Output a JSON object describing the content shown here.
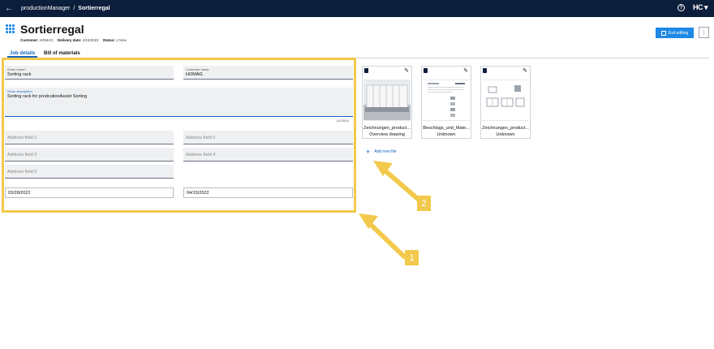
{
  "topbar": {
    "app": "productionManager",
    "separator": "/",
    "page": "Sortierregal",
    "help": "?",
    "logo": "HC"
  },
  "header": {
    "title": "Sortierregal",
    "customer_label": "Customer:",
    "customer_value": "HOMAG",
    "delivery_label": "Delivery date:",
    "delivery_value": "4/15/2022",
    "status_label": "Status:",
    "status_value": "1 New",
    "exit_label": "Exit editing",
    "more": "⋮"
  },
  "tabs": [
    {
      "label": "Job details"
    },
    {
      "label": "Bill of materials"
    }
  ],
  "form": {
    "order_name": {
      "label": "Order name*",
      "value": "Sorting rack"
    },
    "customer_name": {
      "label": "Customer name",
      "value": "HOMAG"
    },
    "order_description": {
      "label": "Order description",
      "value": "Sorting rack for prodcutionAssist Sorting",
      "counter": "(41/300)"
    },
    "address1": {
      "placeholder": "Address field 1"
    },
    "address2": {
      "placeholder": "Address field 2"
    },
    "address3": {
      "placeholder": "Address field 3"
    },
    "address4": {
      "placeholder": "Address field 4"
    },
    "address5": {
      "placeholder": "Address field 5"
    },
    "date1": "03/28/2022",
    "date2": "04/15/2022"
  },
  "files": [
    {
      "name": "Zeichnungen_product...",
      "type": "Overview drawing"
    },
    {
      "name": "Beschlags_und_Mate...",
      "type": "Unknown"
    },
    {
      "name": "Zeichnungen_product...",
      "type": "Unknown"
    }
  ],
  "add_file": "Add new file",
  "callouts": [
    "1",
    "2"
  ],
  "colors": {
    "topbar": "#0b1e3b",
    "accent": "#1e88e5",
    "highlight": "#f2c94c"
  }
}
